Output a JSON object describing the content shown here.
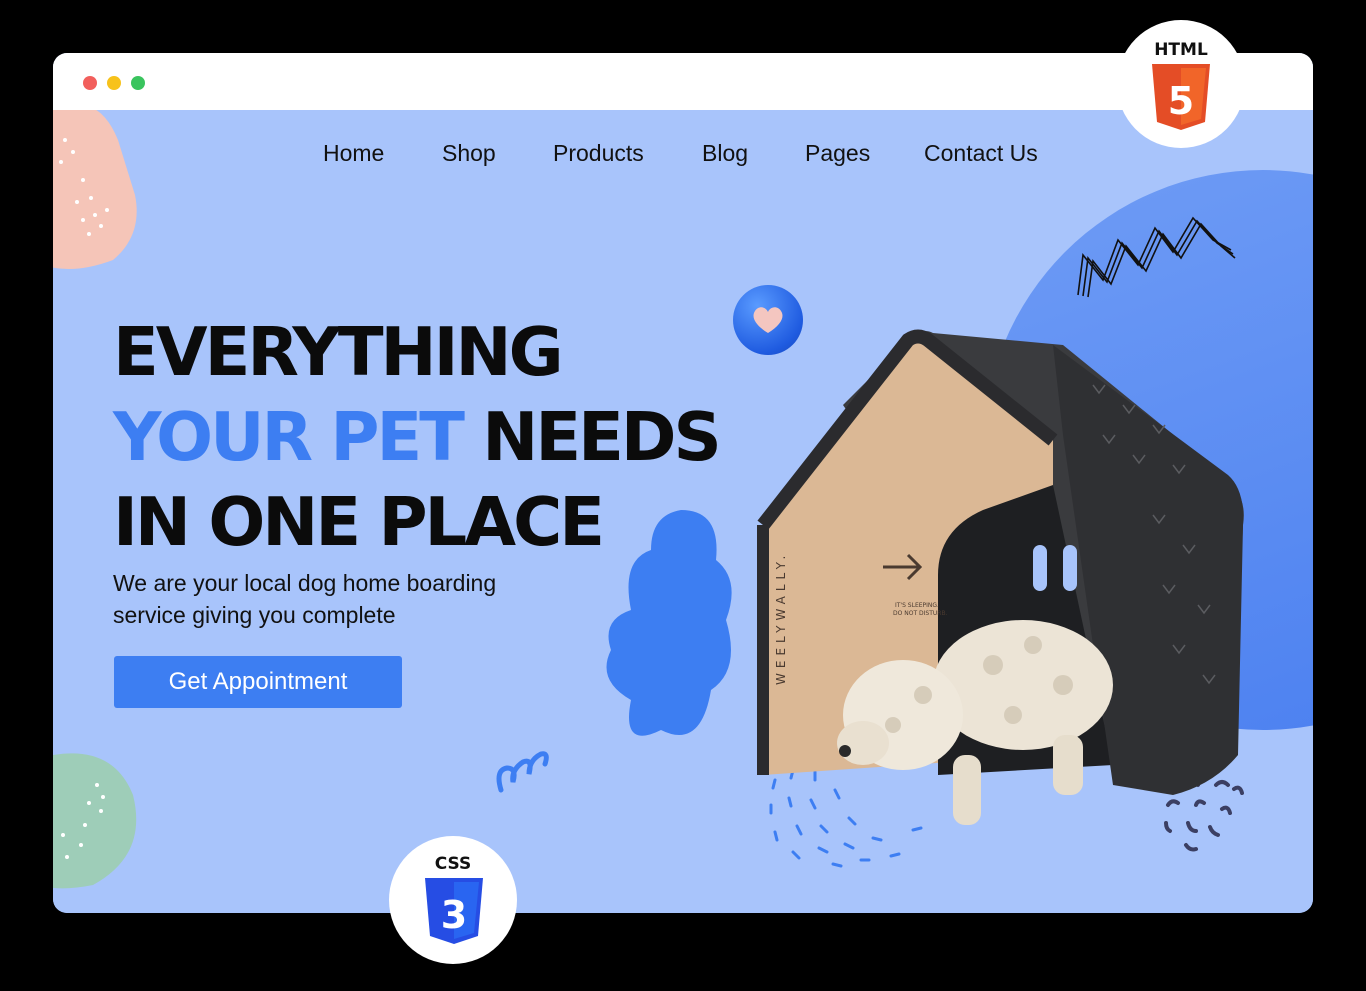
{
  "nav": {
    "items": [
      "Home",
      "Shop",
      "Products",
      "Blog",
      "Pages",
      "Contact Us"
    ]
  },
  "hero": {
    "title_line1": "EVERYTHING",
    "title_accent": "YOUR PET",
    "title_line2_rest": " NEEDS",
    "title_line3": "IN ONE PLACE",
    "subtitle": "We are your local dog home boarding service giving you complete",
    "cta_label": "Get Appointment"
  },
  "product_image": {
    "brand_text": "WEELYWALLY.",
    "door_sign_line1": "IT'S SLEEPING.",
    "door_sign_line2": "DO NOT DISTURB."
  },
  "badges": {
    "html_label": "HTML",
    "html_digit": "5",
    "css_label": "CSS",
    "css_digit": "3"
  },
  "colors": {
    "page_bg": "#a8c4fb",
    "accent": "#3d7ef2",
    "html_orange": "#e44d26",
    "css_blue": "#264de4"
  }
}
